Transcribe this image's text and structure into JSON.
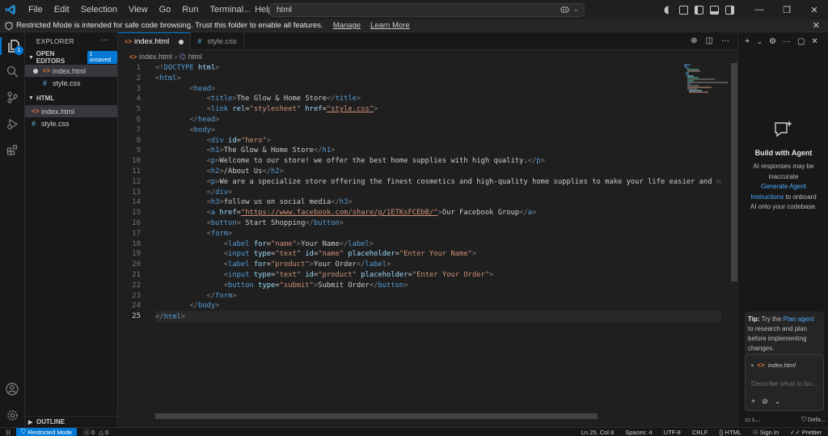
{
  "titlebar": {
    "menu": [
      "File",
      "Edit",
      "Selection",
      "View",
      "Go",
      "Run",
      "Terminal",
      "Help"
    ],
    "search_text": "html"
  },
  "notification": {
    "message": "Restricted Mode is intended for safe code browsing. Trust this folder to enable all features.",
    "manage": "Manage",
    "learn_more": "Learn More"
  },
  "activity": {
    "explorer_badge": "1"
  },
  "sidebar": {
    "title": "EXPLORER",
    "open_editors": "OPEN EDITORS",
    "unsaved_badge": "1 unsaved",
    "open_files": [
      "index.html",
      "style.css"
    ],
    "folder": "HTML",
    "folder_files": [
      "index.html",
      "style.css"
    ],
    "outline": "OUTLINE"
  },
  "tabs": [
    {
      "label": "index.html",
      "active": true,
      "dirty": true
    },
    {
      "label": "style.css",
      "active": false,
      "dirty": false
    }
  ],
  "breadcrumb": {
    "folder": "index.html",
    "symbol": "html"
  },
  "editor": {
    "line_numbers": [
      "1",
      "2",
      "3",
      "4",
      "5",
      "6",
      "7",
      "8",
      "9",
      "10",
      "11",
      "12",
      "13",
      "14",
      "15",
      "16",
      "17",
      "18",
      "19",
      "20",
      "21",
      "22",
      "23",
      "24",
      "25"
    ],
    "current_line": 25
  },
  "chat": {
    "title": "Build with Agent",
    "desc_pre": "AI responses may be inaccurate",
    "desc_link": "Generate Agent Instructions",
    "desc_post": "to onboard AI onto your codebase.",
    "tip_label": "Tip:",
    "tip_pre": "Try the",
    "tip_link": "Plan agent",
    "tip_post": "to research and plan before implementing changes.",
    "context_file": "index.html",
    "input_placeholder": "Describe what to bu...",
    "footer_left": "L...",
    "footer_right": "Defa..."
  },
  "statusbar": {
    "restricted": "Restricted Mode",
    "errors": "0",
    "warnings": "0",
    "position": "Ln 25, Col 8",
    "spaces": "Spaces: 4",
    "encoding": "UTF-8",
    "eol": "CRLF",
    "language": "HTML",
    "signin": "Sign In",
    "prettier": "Prettier"
  },
  "colors": {
    "accent": "#0078d4",
    "tag": "#569cd6",
    "attr": "#9cdcfe",
    "string": "#ce9178"
  }
}
